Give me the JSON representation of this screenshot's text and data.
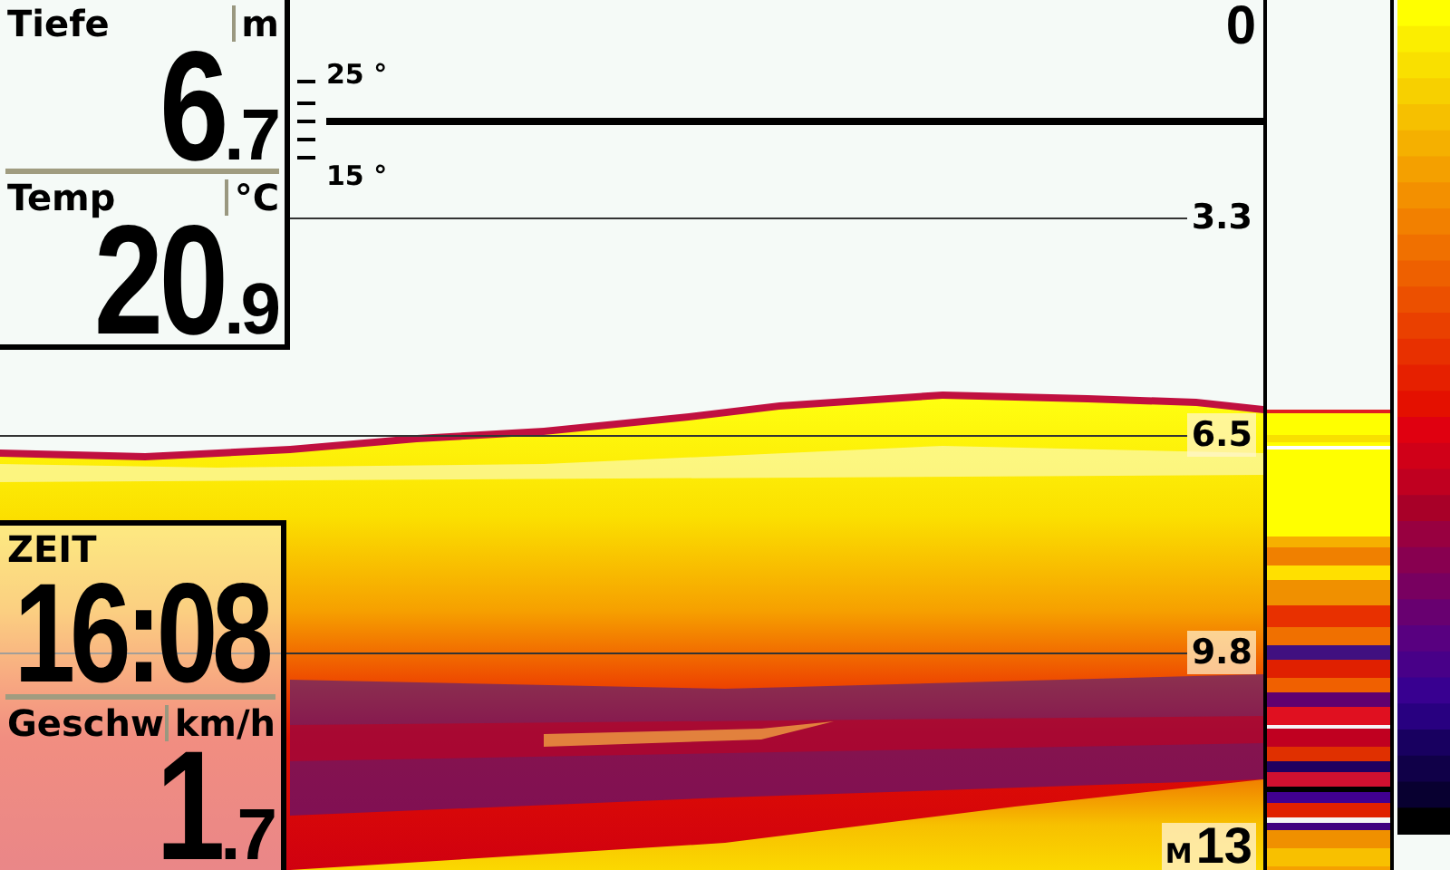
{
  "depth": {
    "label": "Tiefe",
    "unit": "m",
    "whole": "6",
    "fraction": ".7"
  },
  "temp": {
    "label": "Temp",
    "unit": "°C",
    "whole": "20",
    "fraction": ".9"
  },
  "temp_scale": {
    "top": "25 °",
    "bottom": "15 °"
  },
  "depth_scale": [
    {
      "kind": "zero",
      "label": "0"
    },
    {
      "kind": "line",
      "label": "3.3",
      "shaded": false
    },
    {
      "kind": "line",
      "label": "6.5",
      "shaded": true
    },
    {
      "kind": "line",
      "label": "9.8",
      "shaded": true
    },
    {
      "kind": "range",
      "mode": "M",
      "label": "13"
    }
  ],
  "time": {
    "label": "ZEIT",
    "value": "16:08"
  },
  "speed": {
    "label": "Geschw",
    "unit": "km/h",
    "whole": "1",
    "fraction": ".7"
  }
}
